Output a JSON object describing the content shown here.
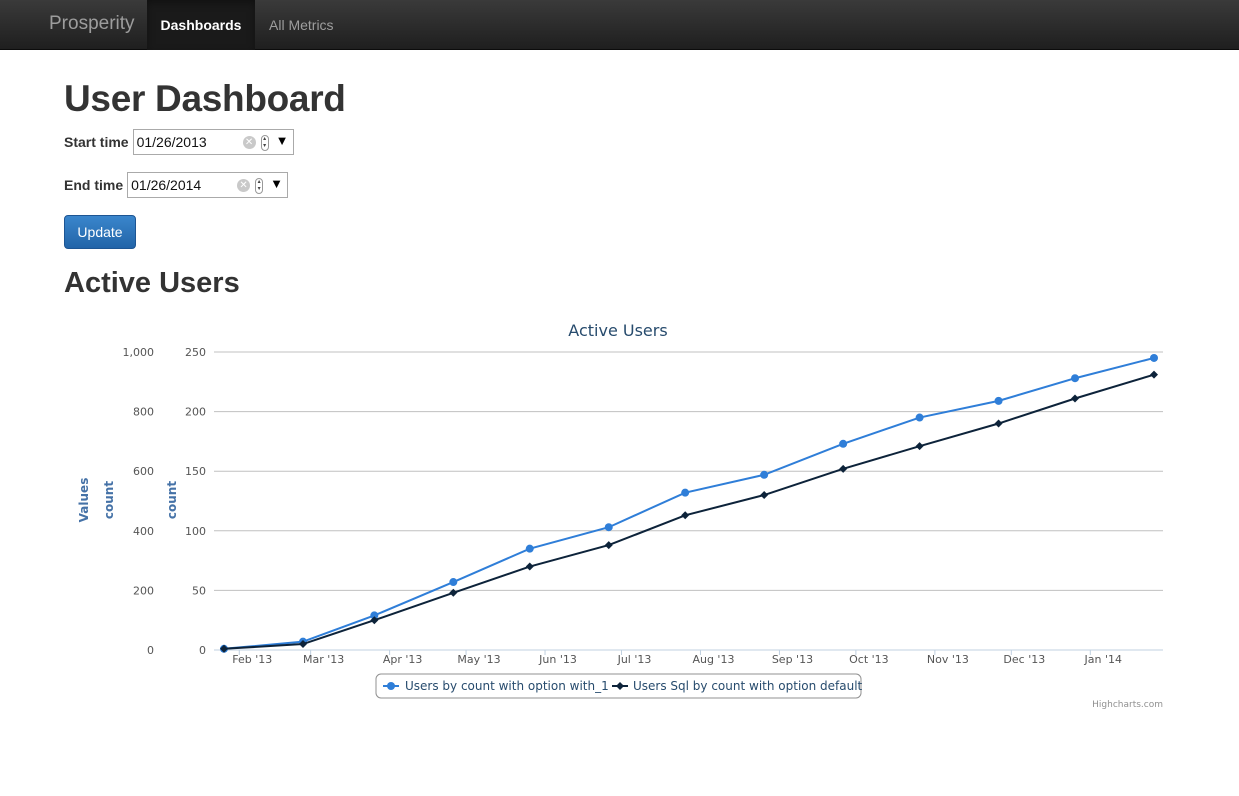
{
  "navbar": {
    "brand": "Prosperity",
    "items": [
      {
        "label": "Dashboards",
        "active": true
      },
      {
        "label": "All Metrics",
        "active": false
      }
    ]
  },
  "page": {
    "title": "User Dashboard",
    "start_label": "Start time",
    "start_value": "01/26/2013",
    "end_label": "End time",
    "end_value": "01/26/2014",
    "update_label": "Update",
    "section_title": "Active Users"
  },
  "icons": {
    "clear": "circle-x",
    "spinner": "up-down",
    "dropdown": "triangle-down"
  },
  "chart_data": {
    "type": "line",
    "title": "Active Users",
    "credits": "Highcharts.com",
    "x": [
      "Feb '13",
      "Mar '13",
      "Apr '13",
      "May '13",
      "Jun '13",
      "Jul '13",
      "Aug '13",
      "Sep '13",
      "Oct '13",
      "Nov '13",
      "Dec '13",
      "Jan '14"
    ],
    "x_dates": [
      "2013-01-26",
      "2013-02-26",
      "2013-03-26",
      "2013-04-26",
      "2013-05-26",
      "2013-06-26",
      "2013-07-26",
      "2013-08-26",
      "2013-09-26",
      "2013-10-26",
      "2013-11-26",
      "2013-12-26",
      "2014-01-26"
    ],
    "axes": [
      {
        "label": "Values",
        "ticks": [
          0,
          200,
          400,
          600,
          800,
          1000
        ],
        "tick_labels": [
          "0",
          "200",
          "400",
          "600",
          "800",
          "1,000"
        ]
      },
      {
        "label": "count",
        "ticks": [],
        "tick_labels": []
      },
      {
        "label": "count",
        "ticks": [
          0,
          50,
          100,
          150,
          200,
          250
        ],
        "tick_labels": [
          "0",
          "50",
          "100",
          "150",
          "200",
          "250"
        ],
        "ylim": [
          0,
          250
        ]
      }
    ],
    "grid": true,
    "legend": "bottom-center",
    "series": [
      {
        "name": "Users by count with option with_1",
        "color": "#2f7ed8",
        "marker": "circle",
        "values": [
          1,
          7,
          29,
          57,
          85,
          103,
          132,
          147,
          173,
          195,
          209,
          228,
          245
        ]
      },
      {
        "name": "Users Sql by count with option default",
        "color": "#0d233a",
        "marker": "diamond",
        "values": [
          1,
          5,
          25,
          48,
          70,
          88,
          113,
          130,
          152,
          171,
          190,
          211,
          231
        ]
      }
    ]
  }
}
